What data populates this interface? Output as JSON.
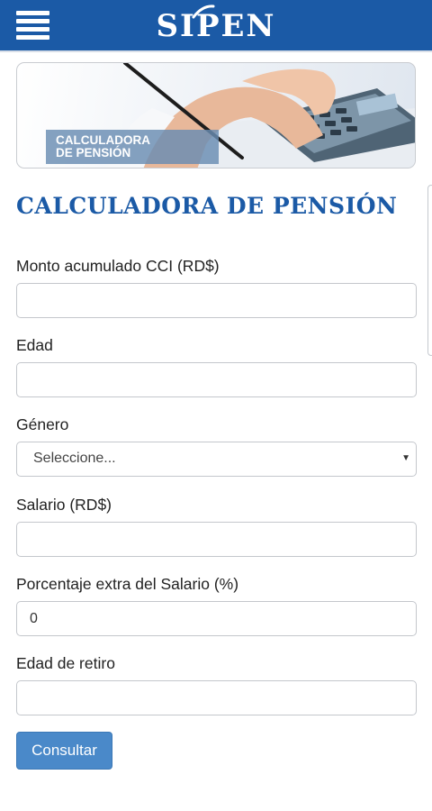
{
  "header": {
    "logo_text": "SIPEN",
    "menu_icon": "hamburger-icon",
    "brand_color": "#1b5aa6"
  },
  "banner": {
    "label_line1": "CALCULADORA",
    "label_line2": "DE PENSIÓN"
  },
  "page_title": "CALCULADORA DE PENSIÓN",
  "form": {
    "cci": {
      "label": "Monto acumulado CCI (RD$)",
      "value": ""
    },
    "edad": {
      "label": "Edad",
      "value": ""
    },
    "genero": {
      "label": "Género",
      "selected": "Seleccione..."
    },
    "salario": {
      "label": "Salario (RD$)",
      "value": ""
    },
    "porcentaje": {
      "label": "Porcentaje extra del Salario (%)",
      "value": "0"
    },
    "edad_retiro": {
      "label": "Edad de retiro",
      "value": ""
    },
    "submit_label": "Consultar"
  },
  "colors": {
    "title": "#1b5aa6",
    "button": "#4a89c9"
  }
}
